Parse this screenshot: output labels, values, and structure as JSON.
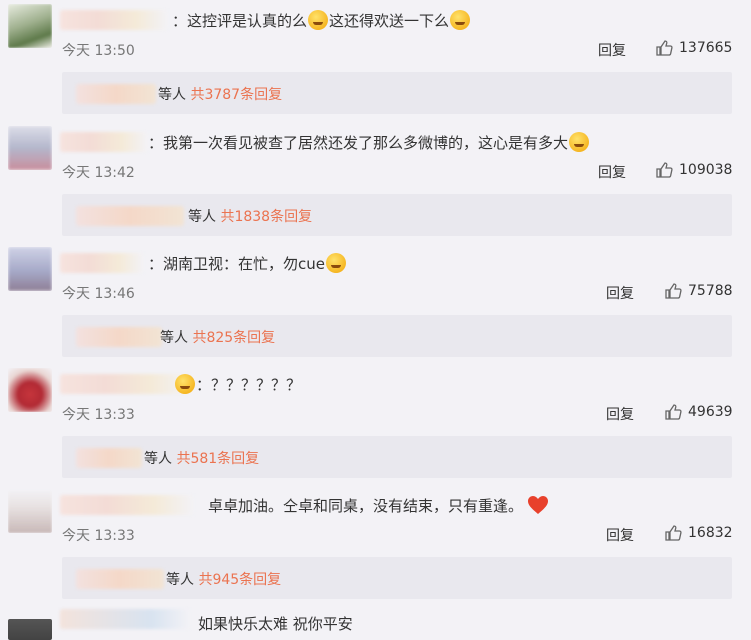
{
  "comments": [
    {
      "text": "：这控评是认真的么",
      "text2": "这还得欢送一下么",
      "time": "今天 13:50",
      "reply": "回复",
      "likes": "137665",
      "summary": {
        "prefix": "等人",
        "count": "共3787条回复"
      }
    },
    {
      "text": "：我第一次看见被查了居然还发了那么多微博的，这心是有多大",
      "time": "今天 13:42",
      "reply": "回复",
      "likes": "109038",
      "summary": {
        "prefix": "等人",
        "count": "共1838条回复"
      }
    },
    {
      "text": "：湖南卫视：在忙，勿cue",
      "time": "今天 13:46",
      "reply": "回复",
      "likes": "75788",
      "summary": {
        "prefix": "等人",
        "count": "共825条回复"
      }
    },
    {
      "text": "：？？？？？？",
      "time": "今天 13:33",
      "reply": "回复",
      "likes": "49639",
      "summary": {
        "prefix": "等人",
        "count": "共581条回复"
      }
    },
    {
      "text": "卓卓加油。仝卓和同桌，没有结束，只有重逢。",
      "time": "今天 13:33",
      "reply": "回复",
      "likes": "16832",
      "summary": {
        "prefix": "等人",
        "count": "共945条回复"
      }
    },
    {
      "text": "如果快乐太难 祝你平安"
    }
  ],
  "colors": {
    "background": "#f3f2f6",
    "summary_bg": "#e9e8ee",
    "reply_count": "#eb7350",
    "heart": "#e8412c"
  },
  "icons": [
    "thumbs-up-icon",
    "smile-emoji-icon",
    "heart-emoji-icon"
  ]
}
